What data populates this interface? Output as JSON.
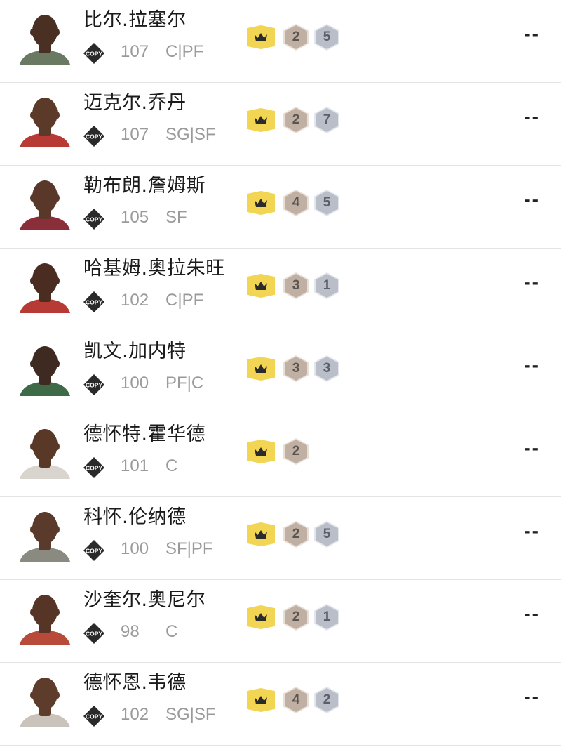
{
  "colors": {
    "crown_gold": "#f2d552",
    "crown_icon": "#2b2b2b",
    "bronze_hex": "#bfb0a3",
    "silver_hex": "#b9bec8",
    "text_primary": "#1b1b1b",
    "text_secondary": "#9a9a9a"
  },
  "players": [
    {
      "name": "比尔.拉塞尔",
      "rating": "107",
      "position": "C|PF",
      "crown_icon": "crown-icon",
      "badge1": "2",
      "badge2": "5",
      "trend": "--",
      "skin": "#4a2f23",
      "jersey": "#6a7a62"
    },
    {
      "name": "迈克尔.乔丹",
      "rating": "107",
      "position": "SG|SF",
      "crown_icon": "crown-icon",
      "badge1": "2",
      "badge2": "7",
      "trend": "--",
      "skin": "#5b3a2a",
      "jersey": "#b83a35"
    },
    {
      "name": "勒布朗.詹姆斯",
      "rating": "105",
      "position": "SF",
      "crown_icon": "crown-icon",
      "badge1": "4",
      "badge2": "5",
      "trend": "--",
      "skin": "#5a3829",
      "jersey": "#8a2f3a"
    },
    {
      "name": "哈基姆.奥拉朱旺",
      "rating": "102",
      "position": "C|PF",
      "crown_icon": "crown-icon",
      "badge1": "3",
      "badge2": "1",
      "trend": "--",
      "skin": "#4a2d20",
      "jersey": "#b83a35"
    },
    {
      "name": "凯文.加内特",
      "rating": "100",
      "position": "PF|C",
      "crown_icon": "crown-icon",
      "badge1": "3",
      "badge2": "3",
      "trend": "--",
      "skin": "#3e2a20",
      "jersey": "#3e6a48"
    },
    {
      "name": "德怀特.霍华德",
      "rating": "101",
      "position": "C",
      "crown_icon": "crown-icon",
      "badge1": "2",
      "badge2": "",
      "trend": "--",
      "skin": "#5a3828",
      "jersey": "#d9d4ce"
    },
    {
      "name": "科怀.伦纳德",
      "rating": "100",
      "position": "SF|PF",
      "crown_icon": "crown-icon",
      "badge1": "2",
      "badge2": "5",
      "trend": "--",
      "skin": "#5a3a2a",
      "jersey": "#8a8a80"
    },
    {
      "name": "沙奎尔.奥尼尔",
      "rating": "98",
      "position": "C",
      "crown_icon": "crown-icon",
      "badge1": "2",
      "badge2": "1",
      "trend": "--",
      "skin": "#563526",
      "jersey": "#b84a3a"
    },
    {
      "name": "德怀恩.韦德",
      "rating": "102",
      "position": "SG|SF",
      "crown_icon": "crown-icon",
      "badge1": "4",
      "badge2": "2",
      "trend": "--",
      "skin": "#5e3c2b",
      "jersey": "#c9c3bc"
    }
  ]
}
